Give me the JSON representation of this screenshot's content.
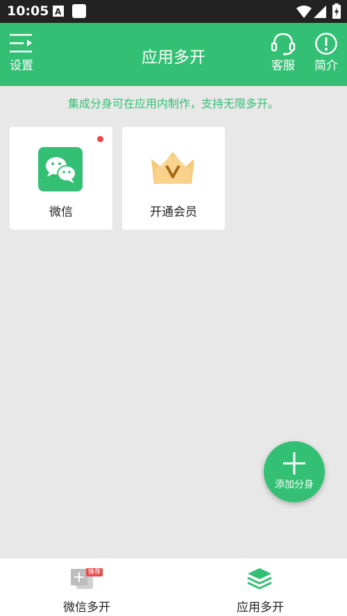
{
  "status_bar": {
    "time": "10:05",
    "icons": [
      "font-icon",
      "square-icon",
      "wifi-icon",
      "signal-icon",
      "battery-icon"
    ]
  },
  "header": {
    "title": "应用多开",
    "settings_label": "设置",
    "support_label": "客服",
    "intro_label": "简介",
    "icons": [
      "menu-icon",
      "headset-icon",
      "info-icon"
    ]
  },
  "tip": "集成分身可在应用内制作，支持无限多开。",
  "apps": [
    {
      "label": "微信",
      "icon": "wechat-icon",
      "has_notification": true
    },
    {
      "label": "开通会员",
      "icon": "vip-crown-icon",
      "has_notification": false
    }
  ],
  "fab": {
    "label": "添加分身",
    "icon": "plus-icon"
  },
  "bottom_nav": {
    "items": [
      {
        "label": "微信多开",
        "icon": "add-clone-icon",
        "badge": "推荐"
      },
      {
        "label": "应用多开",
        "icon": "layers-icon",
        "active": true
      }
    ]
  },
  "colors": {
    "accent": "#33c074",
    "background": "#e8e8e8",
    "status_bar": "#222222",
    "badge": "#e84a4a",
    "vip_gold": "#f6c878"
  }
}
